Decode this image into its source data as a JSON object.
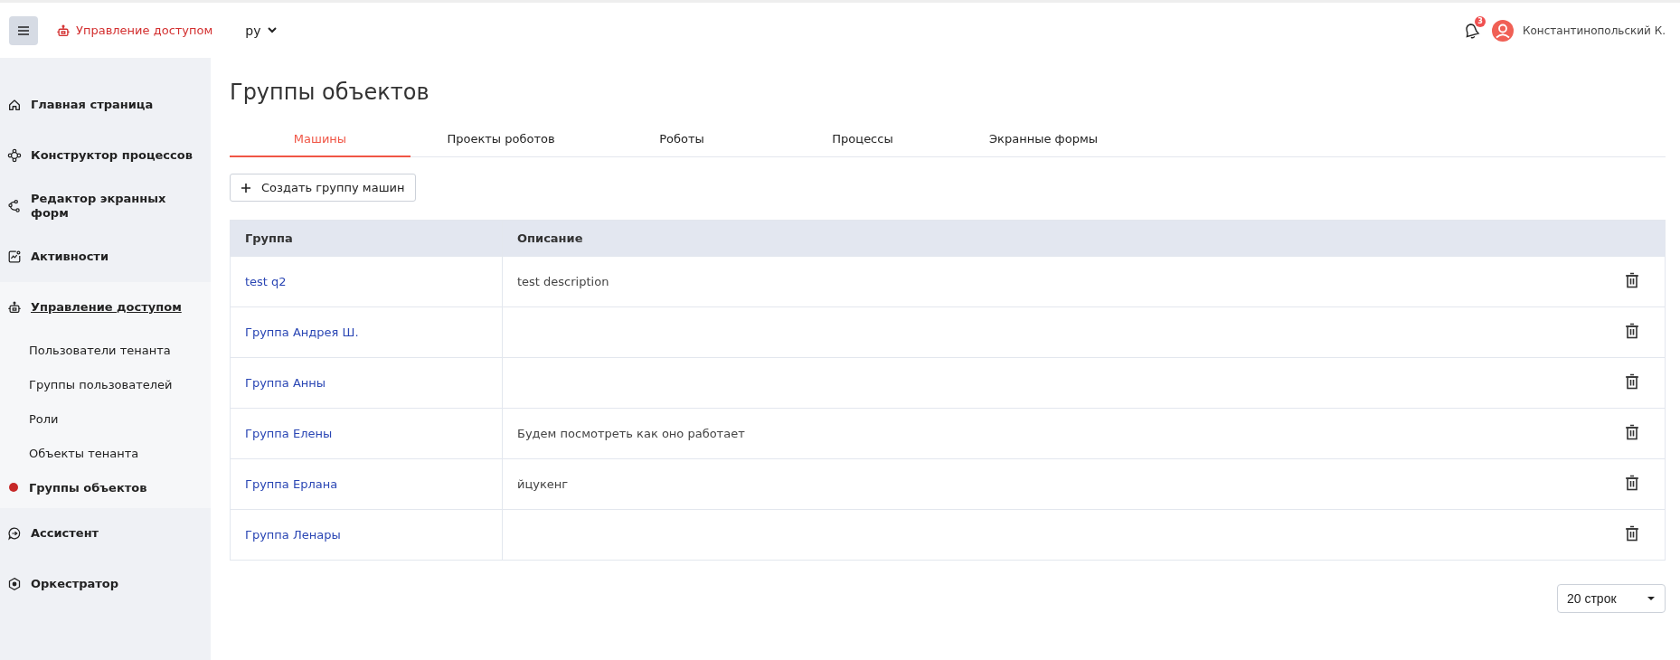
{
  "header": {
    "section": "Управление доступом",
    "language": "ру",
    "notifications": "3",
    "user": "Константинопольский К."
  },
  "sidebar": {
    "items": [
      {
        "label": "Главная страница",
        "expanded": false
      },
      {
        "label": "Конструктор процессов",
        "expanded": false
      },
      {
        "label": "Редактор экранных форм",
        "expanded": false
      },
      {
        "label": "Активности",
        "expanded": false
      },
      {
        "label": "Управление доступом",
        "expanded": true,
        "children": [
          {
            "label": "Пользователи тенанта",
            "selected": false
          },
          {
            "label": "Группы пользователей",
            "selected": false
          },
          {
            "label": "Роли",
            "selected": false
          },
          {
            "label": "Объекты тенанта",
            "selected": false
          },
          {
            "label": "Группы объектов",
            "selected": true
          }
        ]
      },
      {
        "label": "Ассистент",
        "expanded": false
      },
      {
        "label": "Оркестратор",
        "expanded": false
      }
    ]
  },
  "page": {
    "title": "Группы объектов"
  },
  "tabs": [
    {
      "label": "Машины",
      "selected": true
    },
    {
      "label": "Проекты роботов",
      "selected": false
    },
    {
      "label": "Роботы",
      "selected": false
    },
    {
      "label": "Процессы",
      "selected": false
    },
    {
      "label": "Экранные формы",
      "selected": false
    }
  ],
  "create_button": "Создать группу машин",
  "table": {
    "columns": [
      "Группа",
      "Описание"
    ],
    "rows": [
      {
        "group": "test q2",
        "description": "test description"
      },
      {
        "group": "Группа Андрея Ш."
      },
      {
        "group": "Группа Анны"
      },
      {
        "group": "Группа Елены",
        "description": "Будем посмотреть как оно работает"
      },
      {
        "group": "Группа Ерлана",
        "description": "йцукенг"
      },
      {
        "group": "Группа Ленары"
      }
    ]
  },
  "pagination": {
    "rows_per_page": "20 строк"
  }
}
